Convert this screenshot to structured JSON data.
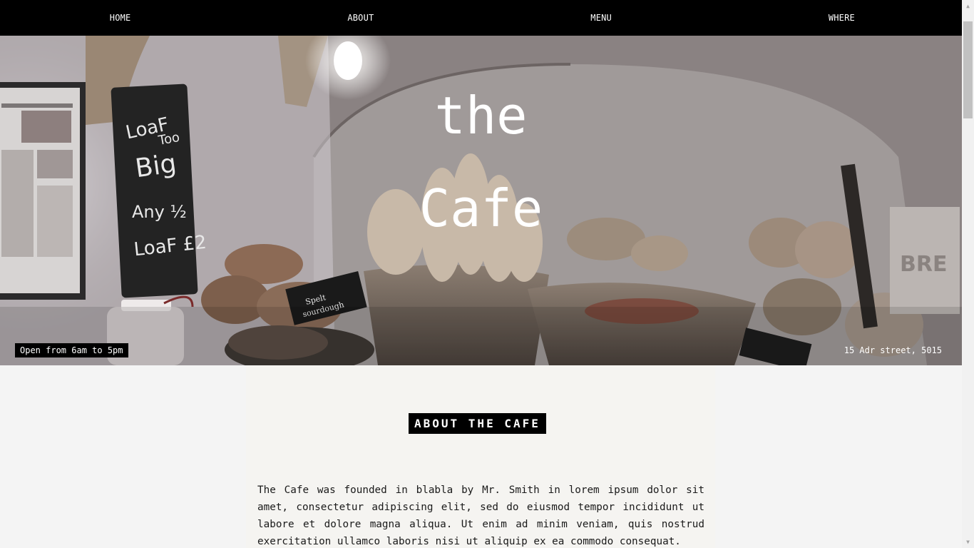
{
  "nav": {
    "items": [
      {
        "label": "HOME"
      },
      {
        "label": "ABOUT"
      },
      {
        "label": "MENU"
      },
      {
        "label": "WHERE"
      }
    ]
  },
  "hero": {
    "title_line1": "the",
    "title_line2": "Cafe",
    "hours": "Open from 6am to 5pm",
    "address": "15 Adr street, 5015",
    "photo_chalkboard_text": "LoaF Too Big Any 1/2 LoaF £2",
    "photo_tag_text": "Spelt sourdough"
  },
  "about": {
    "heading": "ABOUT THE CAFE",
    "body": "The Cafe was founded in blabla by Mr. Smith in lorem ipsum dolor sit amet, consectetur adipiscing elit, sed do eiusmod tempor incididunt ut labore et dolore magna aliqua. Ut enim ad minim veniam, quis nostrud exercitation ullamco laboris nisi ut aliquip ex ea commodo consequat."
  },
  "scrollbar": {
    "up_icon": "triangle-up",
    "down_icon": "triangle-down"
  }
}
